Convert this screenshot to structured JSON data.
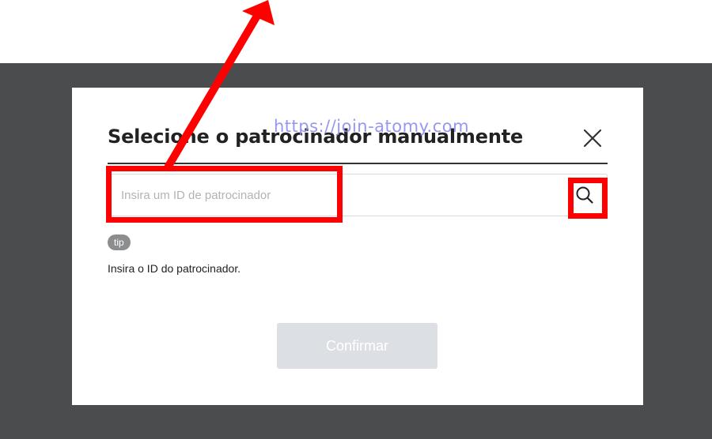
{
  "dialog": {
    "title": "Selecione o patrocinador manualmente",
    "close_icon": "close-icon",
    "search": {
      "placeholder": "Insira um ID de patrocinador",
      "value": "",
      "icon": "search-icon"
    },
    "tip_label": "tip",
    "help_text": "Insira o ID do patrocinador.",
    "confirm_label": "Confirmar"
  },
  "watermark": "https://join-atomy.com",
  "annotations": {
    "color": "#ff0000"
  },
  "colors": {
    "overlay": "#4b4c4e",
    "confirm_disabled": "#dcdfe3",
    "tip_badge": "#8c8d8f"
  }
}
